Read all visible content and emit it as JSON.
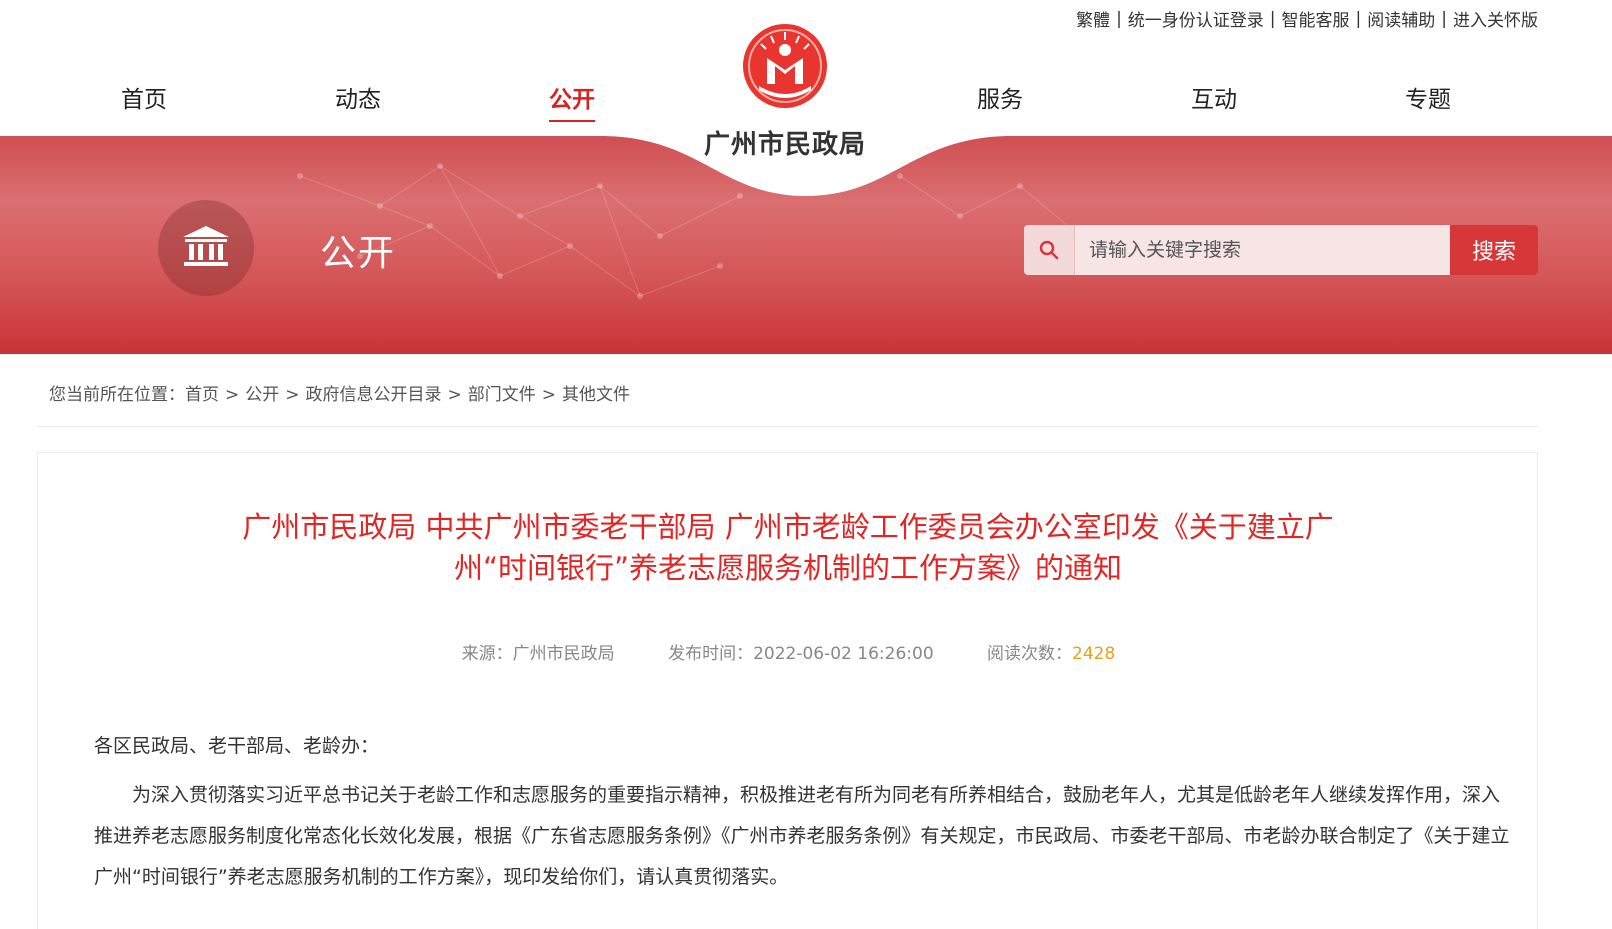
{
  "util_links": [
    "繁體",
    "统一身份认证登录",
    "智能客服",
    "阅读辅助",
    "进入关怀版"
  ],
  "nav": {
    "left": [
      "首页",
      "动态",
      "公开"
    ],
    "right": [
      "服务",
      "互动",
      "专题"
    ],
    "active": "公开"
  },
  "logo": {
    "name": "广州市民政局"
  },
  "banner": {
    "section_title": "公开",
    "search": {
      "placeholder": "请输入关键字搜索",
      "button": "搜索"
    }
  },
  "breadcrumb": {
    "prefix": "您当前所在位置：",
    "items": [
      "首页",
      "公开",
      "政府信息公开目录",
      "部门文件",
      "其他文件"
    ]
  },
  "article": {
    "title_line1": "广州市民政局 中共广州市委老干部局 广州市老龄工作委员会办公室印发《关于建立广",
    "title_line2": "州“时间银行”养老志愿服务机制的工作方案》的通知",
    "source_label": "来源：",
    "source": "广州市民政局",
    "date_label": "发布时间：",
    "date": "2022-06-02 16:26:00",
    "views_label": "阅读次数：",
    "views": "2428",
    "addressee": "各区民政局、老干部局、老龄办：",
    "paragraph": "为深入贯彻落实习近平总书记关于老龄工作和志愿服务的重要指示精神，积极推进老有所为同老有所养相结合，鼓励老年人，尤其是低龄老年人继续发挥作用，深入推进养老志愿服务制度化常态化长效化发展，根据《广东省志愿服务条例》《广州市养老服务条例》有关规定，市民政局、市委老干部局、市老龄办联合制定了《关于建立广州“时间银行”养老志愿服务机制的工作方案》，现印发给你们，请认真贯彻落实。"
  },
  "colors": {
    "accent": "#d72322",
    "title_red": "#e02725",
    "count_orange": "#e6a118",
    "banner": "#d45658"
  },
  "icons": [
    "search-icon",
    "government-building-icon",
    "civil-affairs-logo-icon"
  ]
}
